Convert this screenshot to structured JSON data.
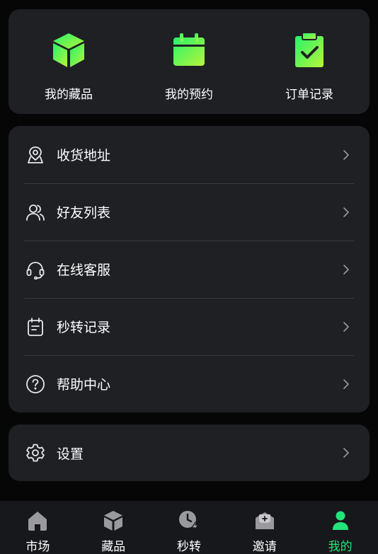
{
  "colors": {
    "background": "#060606",
    "card": "#1f2024",
    "accent_green": "#22e57a",
    "icon_gradient_start": "#24f36b",
    "icon_gradient_end": "#b8f53a",
    "tab_icon_gray": "#9a9a9e"
  },
  "quick_actions": [
    {
      "label": "我的藏品",
      "icon": "cube-icon"
    },
    {
      "label": "我的预约",
      "icon": "calendar-icon"
    },
    {
      "label": "订单记录",
      "icon": "clipboard-check-icon"
    }
  ],
  "menu": [
    {
      "label": "收货地址",
      "icon": "location-pin-icon"
    },
    {
      "label": "好友列表",
      "icon": "users-icon"
    },
    {
      "label": "在线客服",
      "icon": "headset-icon"
    },
    {
      "label": "秒转记录",
      "icon": "calendar-note-icon"
    },
    {
      "label": "帮助中心",
      "icon": "help-circle-icon"
    }
  ],
  "settings": {
    "label": "设置",
    "icon": "gear-icon"
  },
  "tabbar": {
    "tabs": [
      {
        "label": "市场",
        "icon": "home-icon"
      },
      {
        "label": "藏品",
        "icon": "cube-icon"
      },
      {
        "label": "秒转",
        "icon": "clock-bolt-icon"
      },
      {
        "label": "邀请",
        "icon": "envelope-plus-icon"
      },
      {
        "label": "我的",
        "icon": "user-icon",
        "active": true
      }
    ]
  }
}
